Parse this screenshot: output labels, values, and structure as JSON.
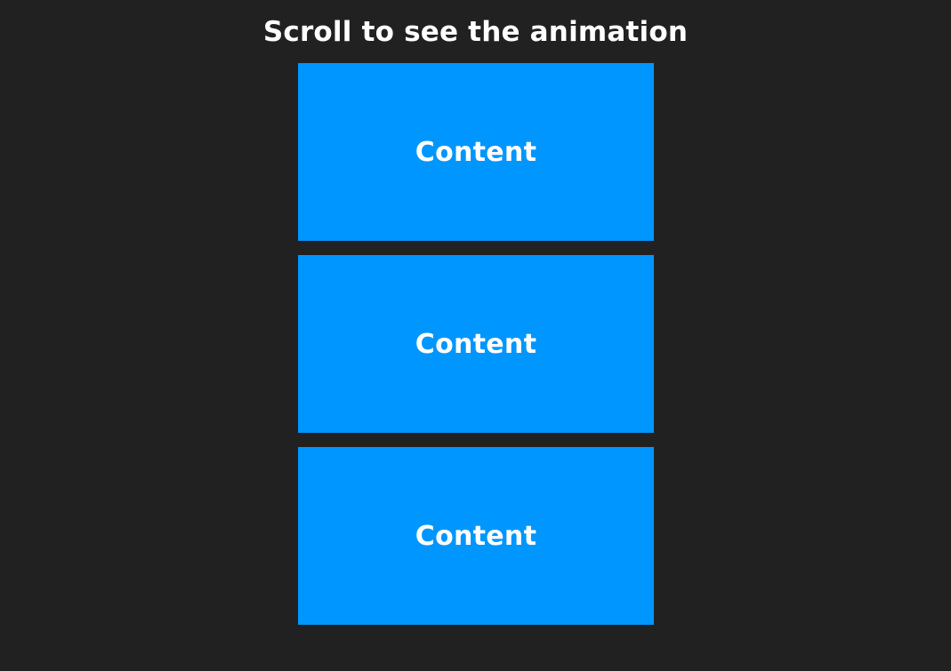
{
  "header": {
    "title": "Scroll to see the animation"
  },
  "boxes": [
    {
      "label": "Content"
    },
    {
      "label": "Content"
    },
    {
      "label": "Content"
    }
  ],
  "colors": {
    "background": "#212121",
    "box": "#0096ff",
    "text": "#ffffff"
  }
}
